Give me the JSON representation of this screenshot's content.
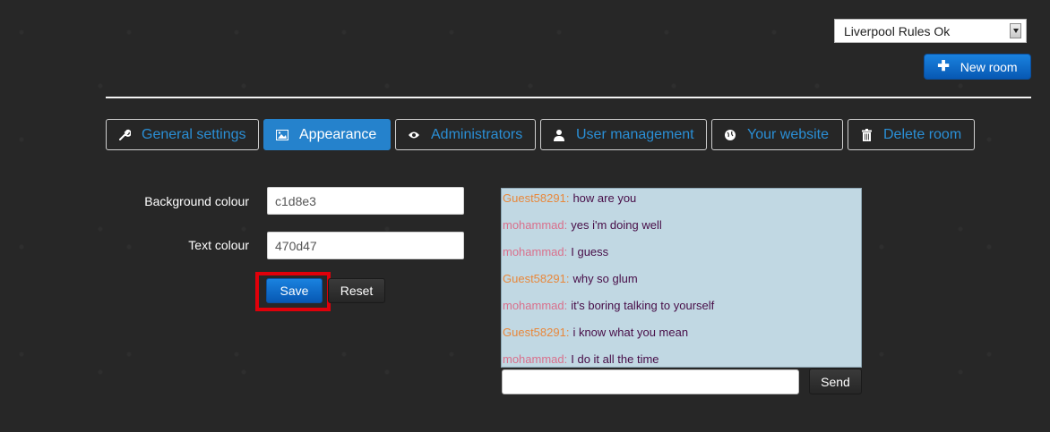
{
  "header": {
    "room_select": {
      "value": "Liverpool Rules Ok"
    },
    "new_room_label": "New room"
  },
  "tabs": [
    {
      "label": "General settings",
      "icon": "wrench-icon"
    },
    {
      "label": "Appearance",
      "icon": "picture-icon",
      "active": true
    },
    {
      "label": "Administrators",
      "icon": "eye-icon"
    },
    {
      "label": "User management",
      "icon": "user-icon"
    },
    {
      "label": "Your website",
      "icon": "globe-icon"
    },
    {
      "label": "Delete room",
      "icon": "trash-icon"
    }
  ],
  "form": {
    "background_label": "Background colour",
    "background_value": "c1d8e3",
    "text_label": "Text colour",
    "text_value": "470d47",
    "save_label": "Save",
    "reset_label": "Reset"
  },
  "chat": {
    "background": "#c1d8e3",
    "text_color": "#470d47",
    "messages": [
      {
        "user": "Guest58291:",
        "text": "how are you"
      },
      {
        "user": "mohammad:",
        "text": "yes i'm doing well"
      },
      {
        "user": "mohammad:",
        "text": "I guess"
      },
      {
        "user": "Guest58291:",
        "text": "why so glum"
      },
      {
        "user": "mohammad:",
        "text": "it's boring talking to yourself"
      },
      {
        "user": "Guest58291:",
        "text": "i know what you mean"
      },
      {
        "user": "mohammad:",
        "text": "I do it all the time"
      }
    ],
    "send_label": "Send"
  },
  "colors": {
    "accent": "#2582cc",
    "highlight": "#e0000a",
    "guest_name": "#e8883c",
    "member_name": "#d9708c"
  }
}
